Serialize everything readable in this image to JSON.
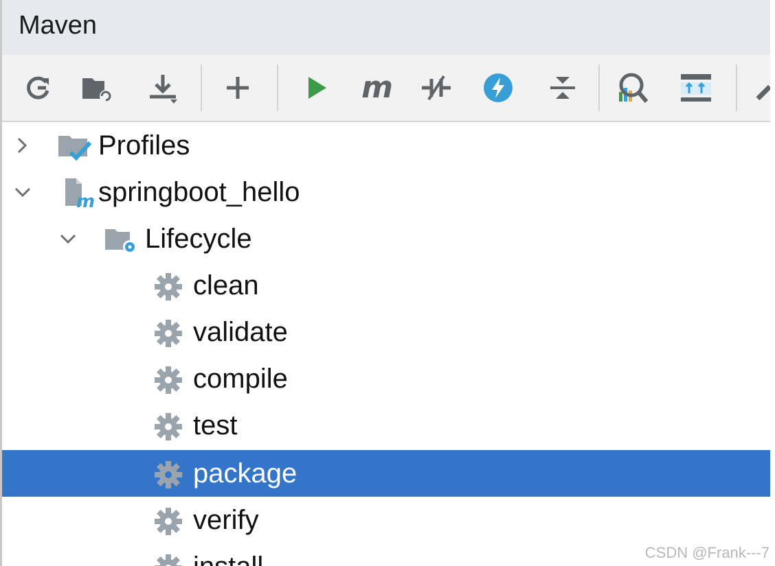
{
  "panel": {
    "title": "Maven"
  },
  "toolbar": {
    "buttons": [
      {
        "icon": "reload-icon"
      },
      {
        "icon": "generate-sources-icon"
      },
      {
        "icon": "download-icon"
      },
      {
        "icon": "add-icon"
      },
      {
        "icon": "run-icon"
      },
      {
        "icon": "maven-goal-icon"
      },
      {
        "icon": "skip-tests-icon"
      },
      {
        "icon": "offline-mode-icon"
      },
      {
        "icon": "collapse-all-icon"
      },
      {
        "icon": "analyze-dependencies-icon"
      },
      {
        "icon": "show-dependencies-icon"
      },
      {
        "icon": "settings-icon"
      }
    ],
    "maven_glyph": "m"
  },
  "tree": {
    "profiles": "Profiles",
    "project": "springboot_hello",
    "lifecycle": "Lifecycle",
    "goals": [
      "clean",
      "validate",
      "compile",
      "test",
      "package",
      "verify",
      "install"
    ],
    "selected_goal": "package"
  },
  "colors": {
    "selection": "#3575c9",
    "run": "#3b9a4a",
    "accent_blue": "#389fd6"
  },
  "watermark": "CSDN @Frank---7"
}
